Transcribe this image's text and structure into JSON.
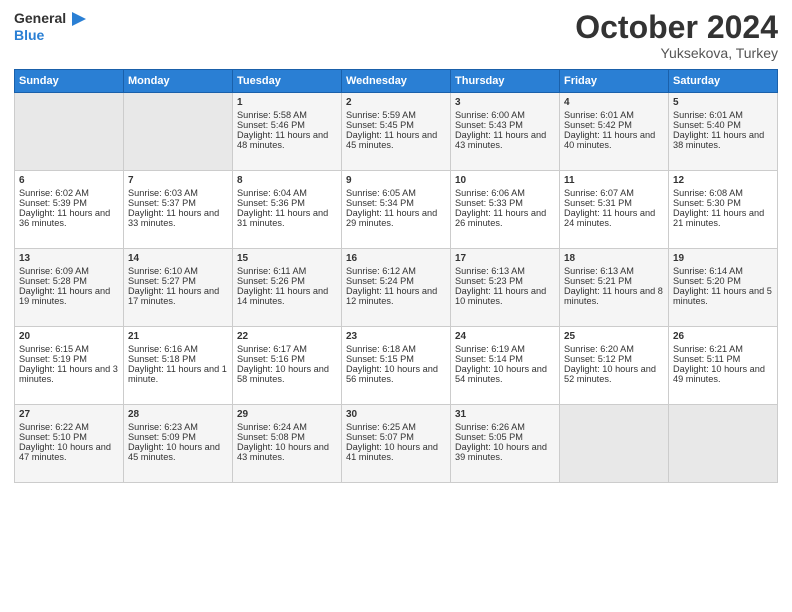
{
  "logo": {
    "general": "General",
    "blue": "Blue"
  },
  "header": {
    "month": "October 2024",
    "location": "Yuksekova, Turkey"
  },
  "weekdays": [
    "Sunday",
    "Monday",
    "Tuesday",
    "Wednesday",
    "Thursday",
    "Friday",
    "Saturday"
  ],
  "weeks": [
    [
      {
        "day": "",
        "info": ""
      },
      {
        "day": "",
        "info": ""
      },
      {
        "day": "1",
        "info": "Sunrise: 5:58 AM\nSunset: 5:46 PM\nDaylight: 11 hours and 48 minutes."
      },
      {
        "day": "2",
        "info": "Sunrise: 5:59 AM\nSunset: 5:45 PM\nDaylight: 11 hours and 45 minutes."
      },
      {
        "day": "3",
        "info": "Sunrise: 6:00 AM\nSunset: 5:43 PM\nDaylight: 11 hours and 43 minutes."
      },
      {
        "day": "4",
        "info": "Sunrise: 6:01 AM\nSunset: 5:42 PM\nDaylight: 11 hours and 40 minutes."
      },
      {
        "day": "5",
        "info": "Sunrise: 6:01 AM\nSunset: 5:40 PM\nDaylight: 11 hours and 38 minutes."
      }
    ],
    [
      {
        "day": "6",
        "info": "Sunrise: 6:02 AM\nSunset: 5:39 PM\nDaylight: 11 hours and 36 minutes."
      },
      {
        "day": "7",
        "info": "Sunrise: 6:03 AM\nSunset: 5:37 PM\nDaylight: 11 hours and 33 minutes."
      },
      {
        "day": "8",
        "info": "Sunrise: 6:04 AM\nSunset: 5:36 PM\nDaylight: 11 hours and 31 minutes."
      },
      {
        "day": "9",
        "info": "Sunrise: 6:05 AM\nSunset: 5:34 PM\nDaylight: 11 hours and 29 minutes."
      },
      {
        "day": "10",
        "info": "Sunrise: 6:06 AM\nSunset: 5:33 PM\nDaylight: 11 hours and 26 minutes."
      },
      {
        "day": "11",
        "info": "Sunrise: 6:07 AM\nSunset: 5:31 PM\nDaylight: 11 hours and 24 minutes."
      },
      {
        "day": "12",
        "info": "Sunrise: 6:08 AM\nSunset: 5:30 PM\nDaylight: 11 hours and 21 minutes."
      }
    ],
    [
      {
        "day": "13",
        "info": "Sunrise: 6:09 AM\nSunset: 5:28 PM\nDaylight: 11 hours and 19 minutes."
      },
      {
        "day": "14",
        "info": "Sunrise: 6:10 AM\nSunset: 5:27 PM\nDaylight: 11 hours and 17 minutes."
      },
      {
        "day": "15",
        "info": "Sunrise: 6:11 AM\nSunset: 5:26 PM\nDaylight: 11 hours and 14 minutes."
      },
      {
        "day": "16",
        "info": "Sunrise: 6:12 AM\nSunset: 5:24 PM\nDaylight: 11 hours and 12 minutes."
      },
      {
        "day": "17",
        "info": "Sunrise: 6:13 AM\nSunset: 5:23 PM\nDaylight: 11 hours and 10 minutes."
      },
      {
        "day": "18",
        "info": "Sunrise: 6:13 AM\nSunset: 5:21 PM\nDaylight: 11 hours and 8 minutes."
      },
      {
        "day": "19",
        "info": "Sunrise: 6:14 AM\nSunset: 5:20 PM\nDaylight: 11 hours and 5 minutes."
      }
    ],
    [
      {
        "day": "20",
        "info": "Sunrise: 6:15 AM\nSunset: 5:19 PM\nDaylight: 11 hours and 3 minutes."
      },
      {
        "day": "21",
        "info": "Sunrise: 6:16 AM\nSunset: 5:18 PM\nDaylight: 11 hours and 1 minute."
      },
      {
        "day": "22",
        "info": "Sunrise: 6:17 AM\nSunset: 5:16 PM\nDaylight: 10 hours and 58 minutes."
      },
      {
        "day": "23",
        "info": "Sunrise: 6:18 AM\nSunset: 5:15 PM\nDaylight: 10 hours and 56 minutes."
      },
      {
        "day": "24",
        "info": "Sunrise: 6:19 AM\nSunset: 5:14 PM\nDaylight: 10 hours and 54 minutes."
      },
      {
        "day": "25",
        "info": "Sunrise: 6:20 AM\nSunset: 5:12 PM\nDaylight: 10 hours and 52 minutes."
      },
      {
        "day": "26",
        "info": "Sunrise: 6:21 AM\nSunset: 5:11 PM\nDaylight: 10 hours and 49 minutes."
      }
    ],
    [
      {
        "day": "27",
        "info": "Sunrise: 6:22 AM\nSunset: 5:10 PM\nDaylight: 10 hours and 47 minutes."
      },
      {
        "day": "28",
        "info": "Sunrise: 6:23 AM\nSunset: 5:09 PM\nDaylight: 10 hours and 45 minutes."
      },
      {
        "day": "29",
        "info": "Sunrise: 6:24 AM\nSunset: 5:08 PM\nDaylight: 10 hours and 43 minutes."
      },
      {
        "day": "30",
        "info": "Sunrise: 6:25 AM\nSunset: 5:07 PM\nDaylight: 10 hours and 41 minutes."
      },
      {
        "day": "31",
        "info": "Sunrise: 6:26 AM\nSunset: 5:05 PM\nDaylight: 10 hours and 39 minutes."
      },
      {
        "day": "",
        "info": ""
      },
      {
        "day": "",
        "info": ""
      }
    ]
  ]
}
